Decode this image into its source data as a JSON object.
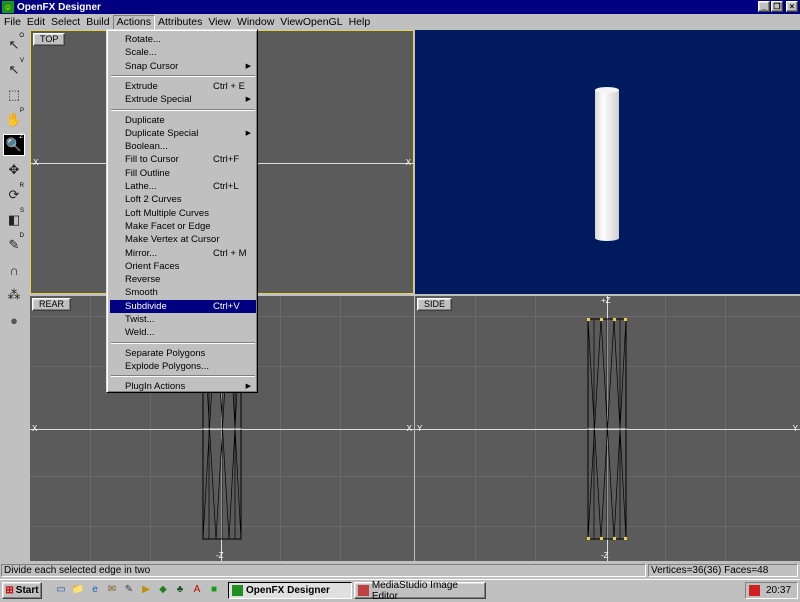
{
  "window": {
    "title": "OpenFX Designer",
    "buttons": [
      "_",
      "❐",
      "×"
    ]
  },
  "menubar": [
    "File",
    "Edit",
    "Select",
    "Build",
    "Actions",
    "Attributes",
    "View",
    "Window",
    "ViewOpenGL",
    "Help"
  ],
  "tools": [
    {
      "icon": "arrow-pointer-icon",
      "glyph": "↖",
      "key": "O"
    },
    {
      "icon": "arrow-select-icon",
      "glyph": "↖",
      "key": "V"
    },
    {
      "icon": "marquee-select-icon",
      "glyph": "⬚",
      "key": ""
    },
    {
      "icon": "hand-pan-icon",
      "glyph": "✋",
      "key": "P"
    },
    {
      "icon": "zoom-icon",
      "glyph": "🔍",
      "key": "Z"
    },
    {
      "icon": "move-icon",
      "glyph": "✥",
      "key": ""
    },
    {
      "icon": "rotate-icon",
      "glyph": "⟳",
      "key": "R"
    },
    {
      "icon": "scale-icon",
      "glyph": "◧",
      "key": "S"
    },
    {
      "icon": "pen-icon",
      "glyph": "✎",
      "key": "D"
    },
    {
      "icon": "magnet-icon",
      "glyph": "∩",
      "key": ""
    },
    {
      "icon": "nodes-icon",
      "glyph": "⁂",
      "key": ""
    },
    {
      "icon": "sphere-icon",
      "glyph": "●",
      "key": ""
    }
  ],
  "viewports": {
    "top": {
      "label": "TOP"
    },
    "rear": {
      "label": "REAR",
      "axis_left": "X",
      "axis_right": "X",
      "axis_bottom": "-Z"
    },
    "side": {
      "label": "SIDE",
      "axis_top": "+Z",
      "axis_left": "Y",
      "axis_right": "Y",
      "axis_bottom": "-Z"
    },
    "top_axis_left": "X",
    "top_axis_right": "X"
  },
  "actions_menu": {
    "groups": [
      [
        {
          "label": "Rotate...",
          "shortcut": "",
          "submenu": false
        },
        {
          "label": "Scale...",
          "shortcut": "",
          "submenu": false
        },
        {
          "label": "Snap Cursor",
          "shortcut": "",
          "submenu": true
        }
      ],
      [
        {
          "label": "Extrude",
          "shortcut": "Ctrl + E",
          "submenu": false
        },
        {
          "label": "Extrude Special",
          "shortcut": "",
          "submenu": true
        }
      ],
      [
        {
          "label": "Duplicate",
          "shortcut": "",
          "submenu": false
        },
        {
          "label": "Duplicate Special",
          "shortcut": "",
          "submenu": true
        },
        {
          "label": "Boolean...",
          "shortcut": "",
          "submenu": false
        },
        {
          "label": "Fill to Cursor",
          "shortcut": "Ctrl+F",
          "submenu": false
        },
        {
          "label": "Fill Outline",
          "shortcut": "",
          "submenu": false
        },
        {
          "label": "Lathe...",
          "shortcut": "Ctrl+L",
          "submenu": false
        },
        {
          "label": "Loft 2 Curves",
          "shortcut": "",
          "submenu": false
        },
        {
          "label": "Loft Multiple Curves",
          "shortcut": "",
          "submenu": false
        },
        {
          "label": "Make Facet or Edge",
          "shortcut": "",
          "submenu": false
        },
        {
          "label": "Make Vertex at Cursor",
          "shortcut": ".",
          "submenu": false
        },
        {
          "label": "Mirror...",
          "shortcut": "Ctrl + M",
          "submenu": false
        },
        {
          "label": "Orient Faces",
          "shortcut": "",
          "submenu": false
        },
        {
          "label": "Reverse",
          "shortcut": "",
          "submenu": false
        },
        {
          "label": "Smooth",
          "shortcut": "",
          "submenu": false
        },
        {
          "label": "Subdivide",
          "shortcut": "Ctrl+V",
          "submenu": false,
          "highlighted": true
        },
        {
          "label": "Twist...",
          "shortcut": "",
          "submenu": false
        },
        {
          "label": "Weld...",
          "shortcut": "",
          "submenu": false
        }
      ],
      [
        {
          "label": "Separate Polygons",
          "shortcut": "",
          "submenu": false
        },
        {
          "label": "Explode Polygons...",
          "shortcut": "",
          "submenu": false
        }
      ],
      [
        {
          "label": "PlugIn Actions",
          "shortcut": "",
          "submenu": true
        }
      ]
    ]
  },
  "status": {
    "message": "Divide each selected edge in two",
    "counts": "Vertices=36(36) Faces=48"
  },
  "taskbar": {
    "start": "Start",
    "quicklaunch": [
      "desktop-icon",
      "explorer-icon",
      "ie-icon",
      "outlook-icon",
      "notepad-icon",
      "media-icon",
      "chip-icon",
      "game-icon",
      "acrobat-icon",
      "openfx-icon"
    ],
    "tasks": [
      {
        "label": "OpenFX Designer",
        "active": true
      },
      {
        "label": "MediaStudio Image Editor",
        "active": false
      }
    ],
    "clock": "20:37"
  },
  "colors": {
    "titlebar": "#000080",
    "viewport": "#5b5b5b",
    "perspective": "#001a5e",
    "accent_active_viewport": "#e6d24a",
    "highlight": "#000080"
  }
}
